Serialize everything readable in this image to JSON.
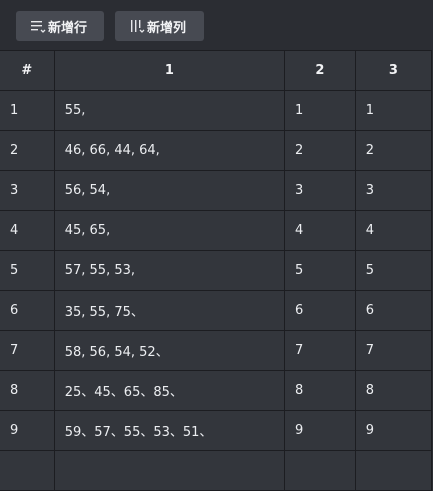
{
  "toolbar": {
    "add_row_label": "新增行",
    "add_row_icon": "add-row-icon",
    "add_column_label": "新增列",
    "add_column_icon": "add-column-icon"
  },
  "table": {
    "headers": [
      "#",
      "1",
      "2",
      "3"
    ],
    "rows": [
      [
        "1",
        "55,",
        "1",
        "1"
      ],
      [
        "2",
        "46, 66, 44, 64,",
        "2",
        "2"
      ],
      [
        "3",
        "56, 54,",
        "3",
        "3"
      ],
      [
        "4",
        "45, 65,",
        "4",
        "4"
      ],
      [
        "5",
        "57, 55, 53,",
        "5",
        "5"
      ],
      [
        "6",
        "35, 55, 75、",
        "6",
        "6"
      ],
      [
        "7",
        "58, 56, 54, 52、",
        "7",
        "7"
      ],
      [
        "8",
        "25、45、65、85、",
        "8",
        "8"
      ],
      [
        "9",
        "59、57、55、53、51、",
        "9",
        "9"
      ],
      [
        "",
        "",
        "",
        ""
      ]
    ]
  },
  "colors": {
    "background": "#2b2d33",
    "cell_background": "#33363c",
    "button_background": "#474a52",
    "grid_line": "#1c1d21"
  }
}
